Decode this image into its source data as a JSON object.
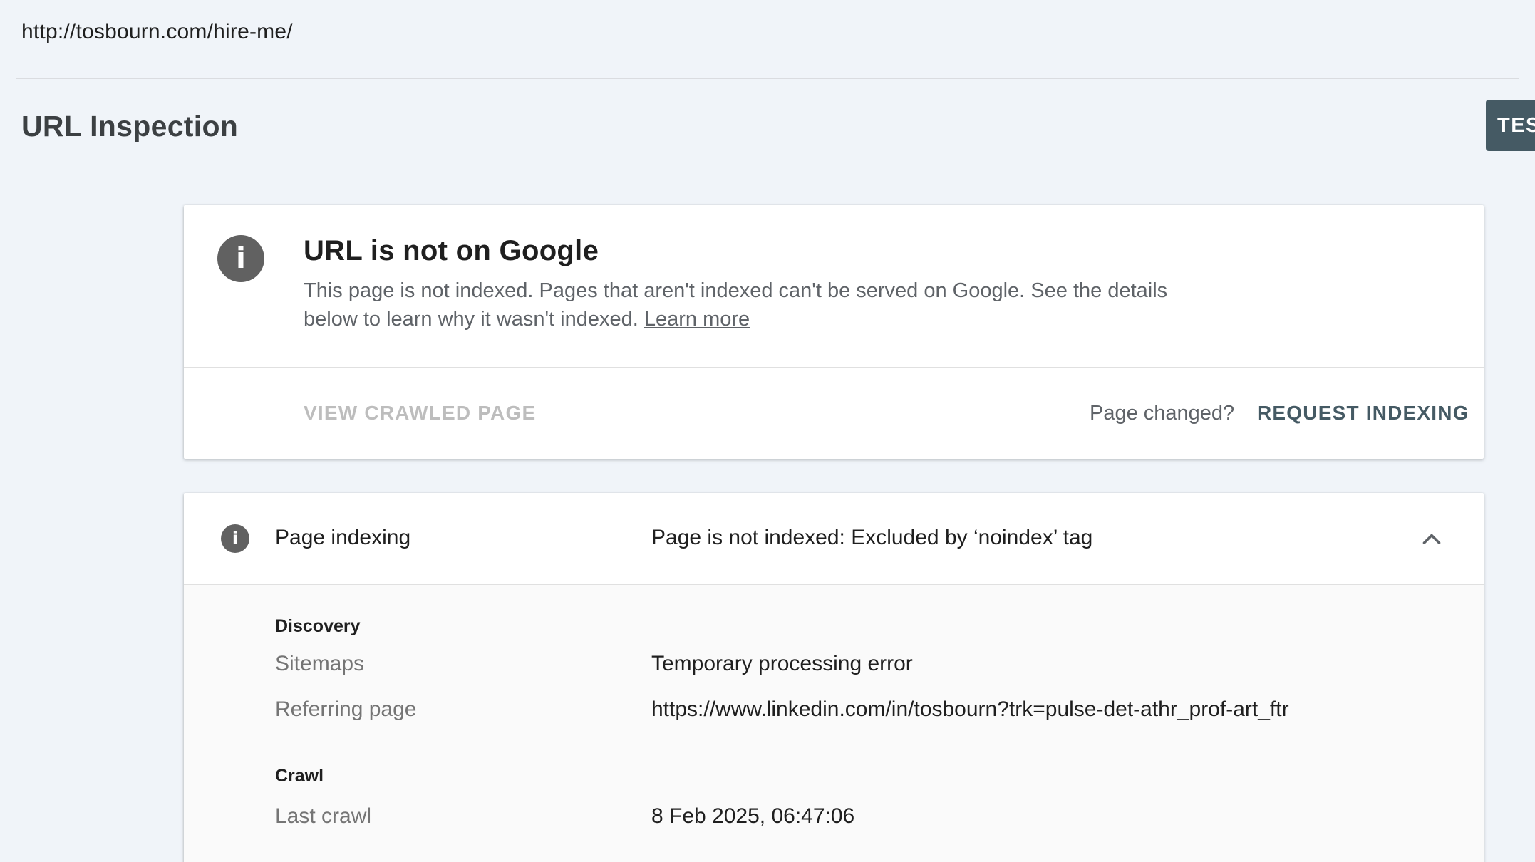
{
  "url_bar": {
    "url": "http://tosbourn.com/hire-me/"
  },
  "header": {
    "title": "URL Inspection",
    "test_button_label": "TES"
  },
  "status_card": {
    "icon": "info-icon",
    "title": "URL is not on Google",
    "description": "This page is not indexed. Pages that aren't indexed can't be served on Google. See the details below to learn why it wasn't indexed.",
    "learn_more": "Learn more",
    "view_crawled_label": "VIEW CRAWLED PAGE",
    "page_changed_text": "Page changed?",
    "request_indexing_label": "REQUEST INDEXING"
  },
  "indexing_card": {
    "icon": "info-icon",
    "label": "Page indexing",
    "value": "Page is not indexed: Excluded by ‘noindex’ tag",
    "chevron": "chevron-up-icon",
    "sections": [
      {
        "title": "Discovery",
        "rows": [
          {
            "label": "Sitemaps",
            "value": "Temporary processing error"
          },
          {
            "label": "Referring page",
            "value": "https://www.linkedin.com/in/tosbourn?trk=pulse-det-athr_prof-art_ftr"
          }
        ]
      },
      {
        "title": "Crawl",
        "rows": [
          {
            "label": "Last crawl",
            "value": "8 Feb 2025, 06:47:06"
          }
        ]
      }
    ]
  },
  "colors": {
    "background": "#f0f4f9",
    "test_button": "#455a64",
    "request_indexing": "#455a64",
    "disabled_action": "#bdbdbd",
    "info_icon": "#616161"
  }
}
